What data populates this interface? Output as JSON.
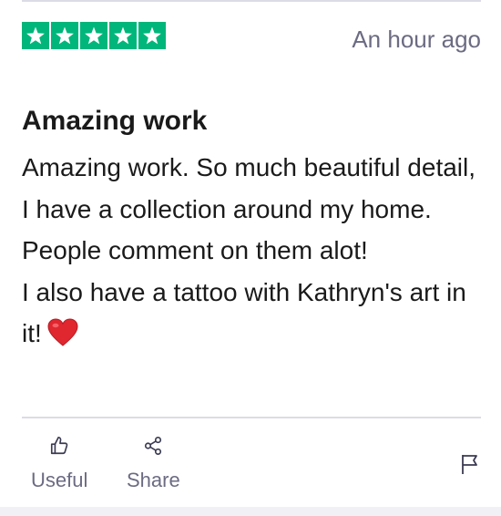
{
  "review": {
    "rating": 5,
    "rating_max": 5,
    "star_color": "#00b67a",
    "timestamp": "An hour ago",
    "title": "Amazing work",
    "body_paragraph_1": "Amazing work. So much beautiful detail, I have a collection around my home. People comment on them alot!",
    "body_paragraph_2": "I also have a tattoo with Kathryn's art in it!",
    "heart_icon": "red-heart-emoji"
  },
  "actions": {
    "useful_label": "Useful",
    "useful_icon": "thumbs-up-icon",
    "share_label": "Share",
    "share_icon": "share-icon",
    "report_icon": "flag-icon"
  },
  "colors": {
    "text": "#1a1a1a",
    "muted": "#6b6b83",
    "divider": "#dcdce6"
  }
}
